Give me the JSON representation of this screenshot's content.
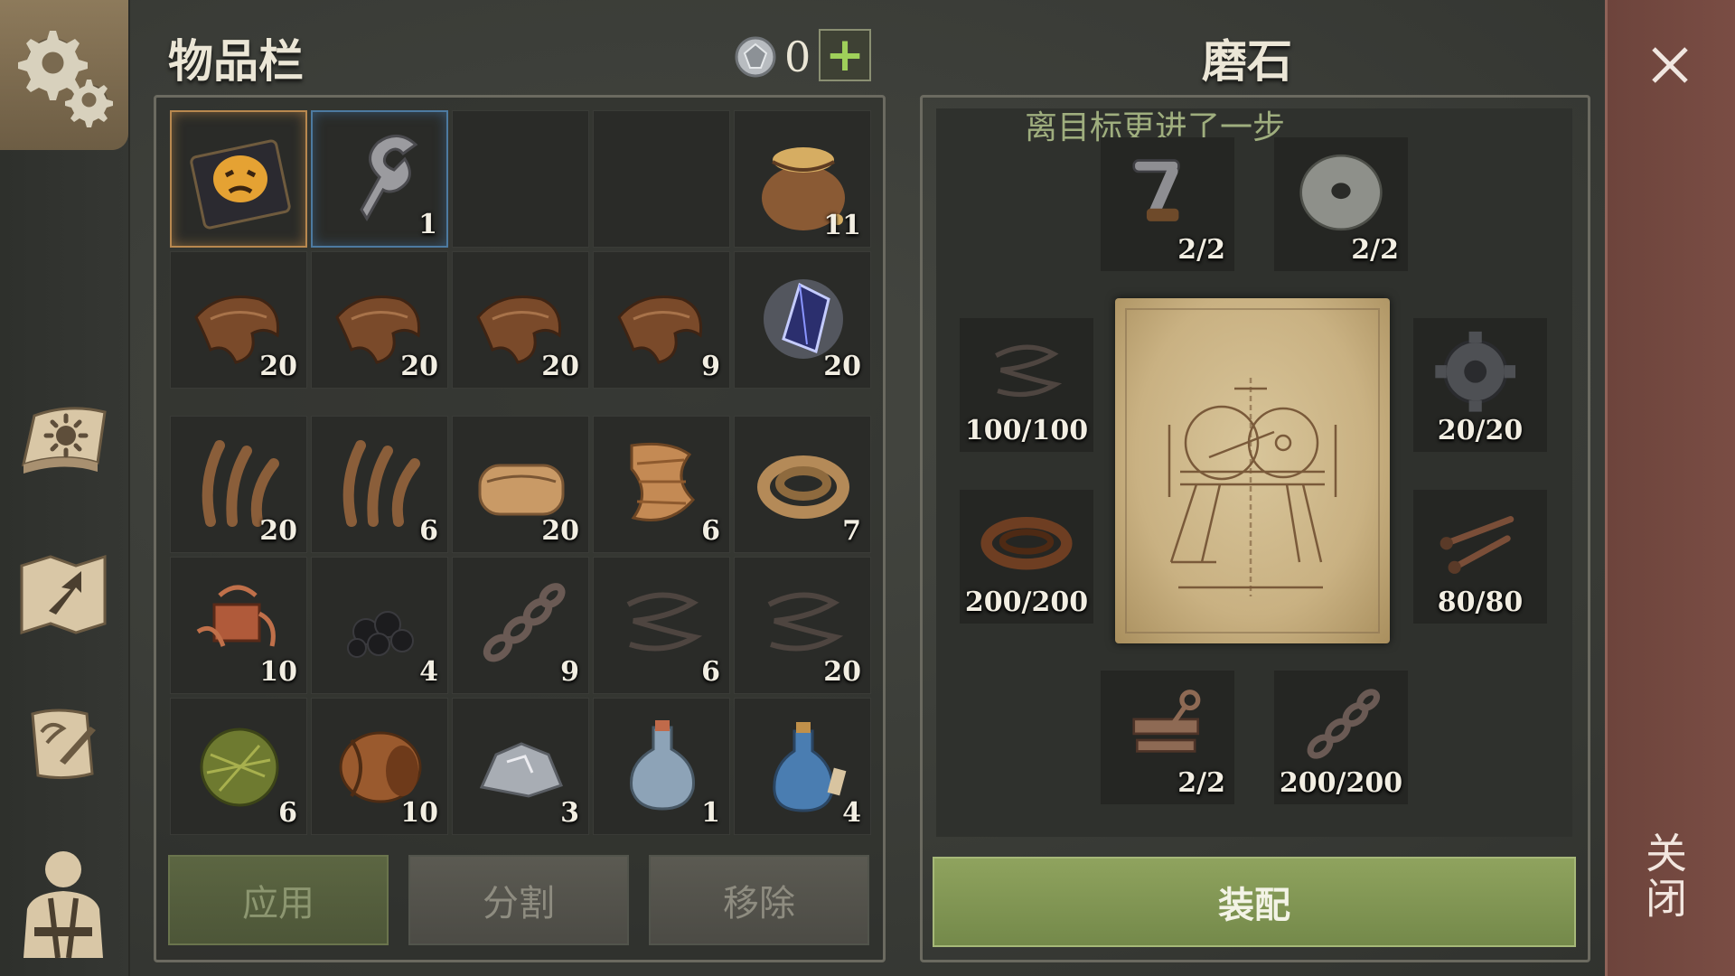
{
  "inventory": {
    "title": "物品栏",
    "currency": {
      "icon": "gem-coin-icon",
      "value": "0",
      "add_label": "+"
    },
    "rows": [
      [
        {
          "name": "recipe-book-icon",
          "count": "",
          "highlight": "gold"
        },
        {
          "name": "wrench-part-icon",
          "count": "1",
          "highlight": "blue"
        },
        {
          "name": "empty",
          "count": ""
        },
        {
          "name": "empty",
          "count": ""
        },
        {
          "name": "grain-sack-icon",
          "count": "11"
        }
      ],
      [
        {
          "name": "leather-hide-icon",
          "count": "20"
        },
        {
          "name": "leather-hide-icon",
          "count": "20"
        },
        {
          "name": "leather-hide-icon",
          "count": "20"
        },
        {
          "name": "leather-hide-icon",
          "count": "9"
        },
        {
          "name": "crystal-shard-icon",
          "count": "20"
        }
      ],
      [
        {
          "name": "fiber-icon",
          "count": "20"
        },
        {
          "name": "fiber-icon",
          "count": "6"
        },
        {
          "name": "cloth-roll-icon",
          "count": "20"
        },
        {
          "name": "burlap-icon",
          "count": "6"
        },
        {
          "name": "rope-icon",
          "count": "7"
        }
      ],
      [
        {
          "name": "copper-scrap-icon",
          "count": "10"
        },
        {
          "name": "coal-icon",
          "count": "4"
        },
        {
          "name": "chain-icon",
          "count": "9"
        },
        {
          "name": "wire-icon",
          "count": "6"
        },
        {
          "name": "wire-icon",
          "count": "20"
        }
      ],
      [
        {
          "name": "grass-ball-icon",
          "count": "6"
        },
        {
          "name": "barrel-icon",
          "count": "10"
        },
        {
          "name": "stone-ore-icon",
          "count": "3"
        },
        {
          "name": "flask-icon",
          "count": "1"
        },
        {
          "name": "water-bottle-icon",
          "count": "4"
        }
      ]
    ],
    "buttons": {
      "apply": "应用",
      "split": "分割",
      "remove": "移除"
    }
  },
  "crafting": {
    "title": "磨石",
    "hint": "离目标更进了一步",
    "slots": [
      {
        "name": "crank-handle-icon",
        "count": "2/2"
      },
      {
        "name": "grindstone-wheel-icon",
        "count": "2/2"
      },
      {
        "name": "wire-icon",
        "count": "100/100"
      },
      {
        "name": "gear-part-icon",
        "count": "20/20"
      },
      {
        "name": "leather-strap-icon",
        "count": "200/200"
      },
      {
        "name": "nails-icon",
        "count": "80/80"
      },
      {
        "name": "metal-frame-icon",
        "count": "2/2"
      },
      {
        "name": "chain-icon",
        "count": "200/200"
      }
    ],
    "assemble_label": "装配"
  },
  "close": {
    "label": "关闭"
  },
  "colors": {
    "accent_green": "#8fa35e",
    "close_red": "#7a4d44",
    "hint_green": "#9fae7e"
  }
}
